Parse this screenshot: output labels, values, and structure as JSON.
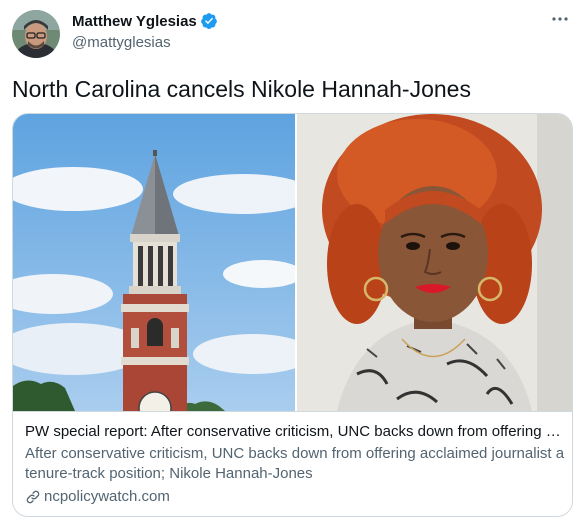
{
  "author": {
    "name": "Matthew Yglesias",
    "handle": "@mattyglesias",
    "verified": true
  },
  "tweet": {
    "text": "North Carolina cancels Nikole Hannah-Jones"
  },
  "card": {
    "title": "PW special report: After conservative criticism, UNC backs down from offering a...",
    "description": "After conservative criticism, UNC backs down from offering acclaimed journalist a tenure-track position; Nikole Hannah-Jones",
    "domain": "ncpolicywatch.com",
    "image_left": "bell-tower-photo",
    "image_right": "portrait-photo"
  },
  "icons": {
    "verified": "verified-badge-icon",
    "more": "more-icon",
    "link": "link-icon"
  },
  "colors": {
    "primary_text": "#0f1419",
    "secondary_text": "#536471",
    "verified_blue": "#1d9bf0",
    "border": "#cfd9de"
  }
}
